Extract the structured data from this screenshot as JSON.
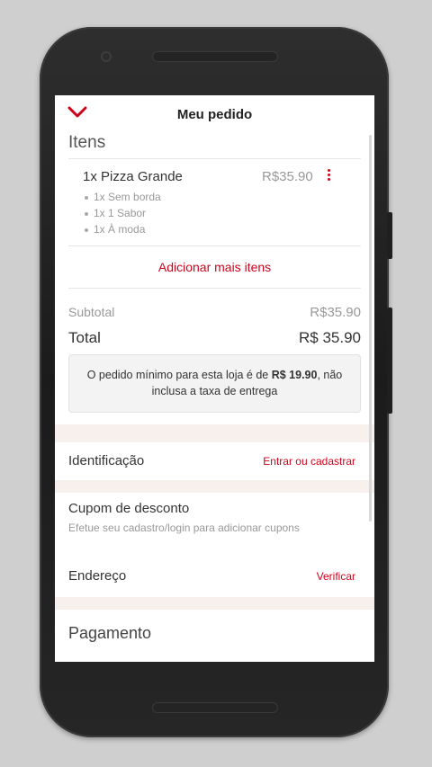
{
  "header": {
    "title": "Meu pedido",
    "icon": "chevron-down-icon",
    "accent": "#d0021b"
  },
  "items_section": {
    "title": "Itens"
  },
  "order_items": [
    {
      "name": "1x Pizza Grande",
      "price": "R$35.90",
      "options": [
        "1x Sem borda",
        "1x 1 Sabor",
        "1x À moda"
      ]
    }
  ],
  "add_more": "Adicionar mais itens",
  "totals": {
    "subtotal_label": "Subtotal",
    "subtotal_value": "R$35.90",
    "total_label": "Total",
    "total_value": "R$ 35.90"
  },
  "notice": {
    "prefix": "O pedido mínimo para esta loja é de ",
    "amount": "R$ 19.90",
    "suffix": ", não inclusa a taxa de entrega"
  },
  "identification": {
    "label": "Identificação",
    "link": "Entrar ou cadastrar"
  },
  "coupon": {
    "label": "Cupom de desconto",
    "hint": "Efetue seu cadastro/login para adicionar cupons"
  },
  "address": {
    "label": "Endereço",
    "link": "Verificar"
  },
  "payment": {
    "label": "Pagamento"
  }
}
